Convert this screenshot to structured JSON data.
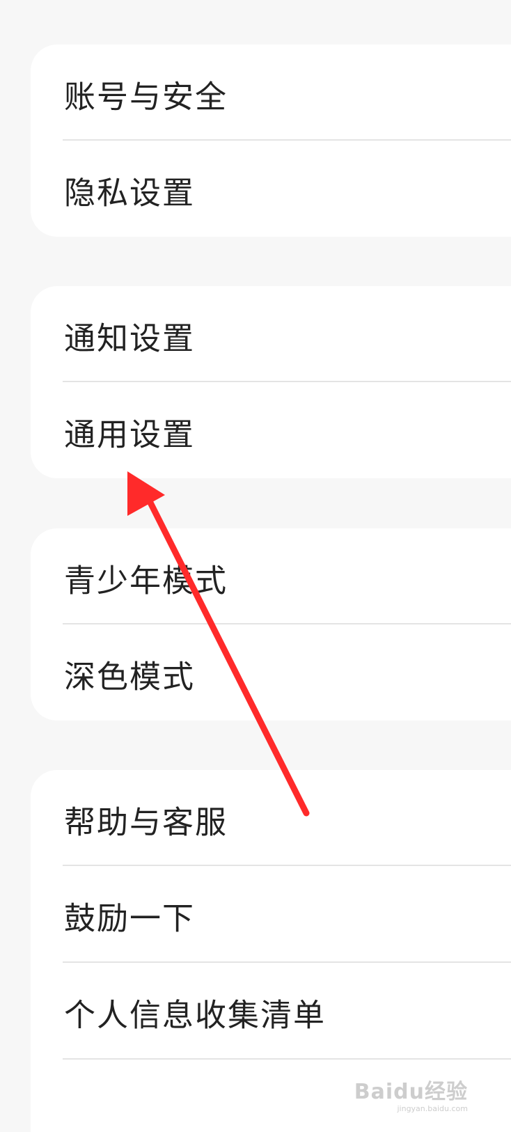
{
  "groups": [
    {
      "items": [
        {
          "label": "账号与安全"
        },
        {
          "label": "隐私设置"
        }
      ]
    },
    {
      "items": [
        {
          "label": "通知设置"
        },
        {
          "label": "通用设置"
        }
      ]
    },
    {
      "items": [
        {
          "label": "青少年模式"
        },
        {
          "label": "深色模式"
        }
      ]
    },
    {
      "items": [
        {
          "label": "帮助与客服"
        },
        {
          "label": "鼓励一下"
        },
        {
          "label": "个人信息收集清单"
        }
      ]
    }
  ],
  "annotation": {
    "arrow_color": "#ff2a2a",
    "points_to": "通用设置"
  },
  "watermark": {
    "logo": "Baidu经验",
    "domain": "jingyan.baidu.com"
  }
}
